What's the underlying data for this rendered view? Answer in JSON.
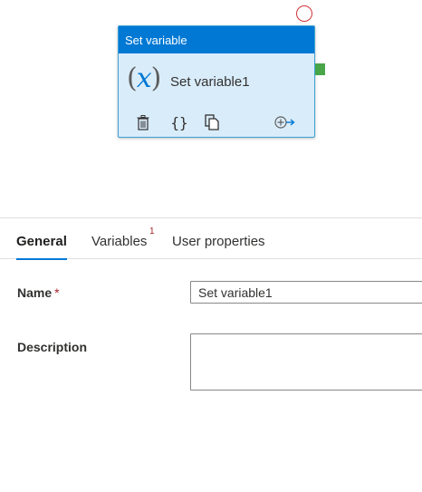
{
  "node": {
    "type_title": "Set variable",
    "name": "Set variable1",
    "icon": "variable-fx-icon",
    "fx_open": "(",
    "fx_var": "x",
    "fx_close": ")",
    "code_glyph": "{}",
    "actions": [
      "delete-icon",
      "code-icon",
      "copy-icon",
      "add-output-icon"
    ]
  },
  "tabs": [
    {
      "label": "General",
      "active": true
    },
    {
      "label": "Variables",
      "badge": "1"
    },
    {
      "label": "User properties"
    }
  ],
  "form": {
    "name_label": "Name",
    "required_marker": "*",
    "name_value": "Set variable1",
    "description_label": "Description",
    "description_value": ""
  },
  "colors": {
    "header": "#0078d4",
    "node_bg": "#d9ecfa",
    "success": "#48a548",
    "failure": "#d13438",
    "required": "#a4262c"
  }
}
